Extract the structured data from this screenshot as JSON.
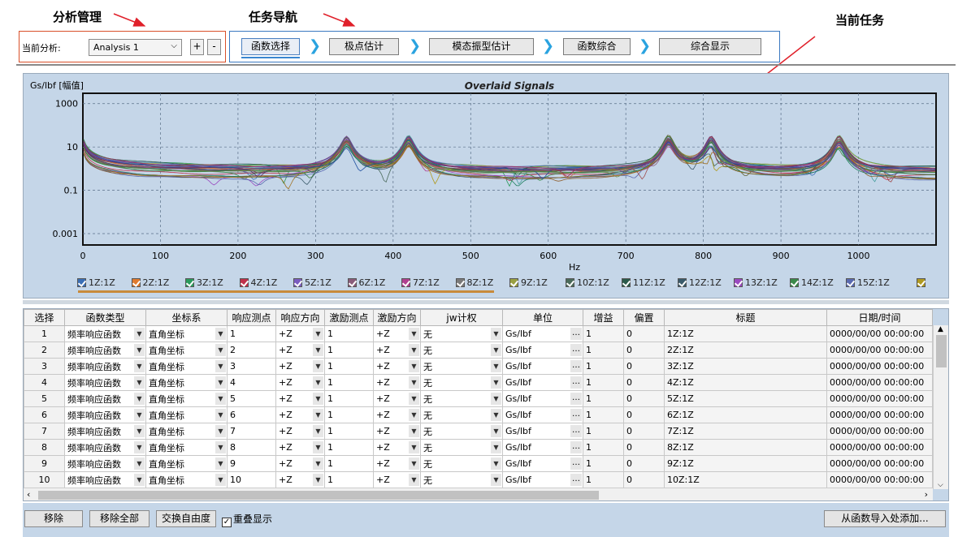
{
  "annotations": {
    "analysis_mgmt": "分析管理",
    "task_nav": "任务导航",
    "current_task": "当前任务"
  },
  "analysis": {
    "label": "当前分析:",
    "value": "Analysis 1",
    "plus": "+",
    "minus": "-"
  },
  "steps": [
    "函数选择",
    "极点估计",
    "模态振型估计",
    "函数综合",
    "综合显示"
  ],
  "chart_data": {
    "type": "line",
    "title": "Overlaid Signals",
    "ylabel": "Gs/lbf [幅值]",
    "xlabel": "Hz",
    "yscale": "log",
    "ylim": [
      0.0003,
      3000
    ],
    "xlim": [
      0,
      1100
    ],
    "yticks": [
      "1000",
      "10",
      "0.1",
      "0.001"
    ],
    "xticks": [
      "0",
      "100",
      "200",
      "300",
      "400",
      "500",
      "600",
      "700",
      "800",
      "900",
      "1000"
    ],
    "grid": true,
    "peaks_hz": [
      340,
      420,
      755,
      810,
      975
    ],
    "legend": [
      "1Z:1Z",
      "2Z:1Z",
      "3Z:1Z",
      "4Z:1Z",
      "5Z:1Z",
      "6Z:1Z",
      "7Z:1Z",
      "8Z:1Z",
      "9Z:1Z",
      "10Z:1Z",
      "11Z:1Z",
      "12Z:1Z",
      "13Z:1Z",
      "14Z:1Z",
      "15Z:1Z"
    ],
    "legend_colors": [
      "#3b6fb5",
      "#e07a2e",
      "#2a9a5c",
      "#c0304a",
      "#7a5cc0",
      "#8a5c7a",
      "#b04090",
      "#7a7a7a",
      "#9aa040",
      "#4a6a5a",
      "#2a5a4a",
      "#3a5a6a",
      "#9a4ac0",
      "#3a8a4a",
      "#5a6ab0",
      "#b09a20"
    ]
  },
  "table": {
    "headers": [
      "选择",
      "函数类型",
      "坐标系",
      "响应测点",
      "响应方向",
      "激励测点",
      "激励方向",
      "jw计权",
      "单位",
      "增益",
      "偏置",
      "标题",
      "日期/时间"
    ],
    "rows": [
      [
        "1",
        "频率响应函数",
        "直角坐标",
        "1",
        "+Z",
        "1",
        "+Z",
        "无",
        "Gs/lbf",
        "1",
        "0",
        "1Z:1Z",
        "0000/00/00 00:00:00"
      ],
      [
        "2",
        "频率响应函数",
        "直角坐标",
        "2",
        "+Z",
        "1",
        "+Z",
        "无",
        "Gs/lbf",
        "1",
        "0",
        "2Z:1Z",
        "0000/00/00 00:00:00"
      ],
      [
        "3",
        "频率响应函数",
        "直角坐标",
        "3",
        "+Z",
        "1",
        "+Z",
        "无",
        "Gs/lbf",
        "1",
        "0",
        "3Z:1Z",
        "0000/00/00 00:00:00"
      ],
      [
        "4",
        "频率响应函数",
        "直角坐标",
        "4",
        "+Z",
        "1",
        "+Z",
        "无",
        "Gs/lbf",
        "1",
        "0",
        "4Z:1Z",
        "0000/00/00 00:00:00"
      ],
      [
        "5",
        "频率响应函数",
        "直角坐标",
        "5",
        "+Z",
        "1",
        "+Z",
        "无",
        "Gs/lbf",
        "1",
        "0",
        "5Z:1Z",
        "0000/00/00 00:00:00"
      ],
      [
        "6",
        "频率响应函数",
        "直角坐标",
        "6",
        "+Z",
        "1",
        "+Z",
        "无",
        "Gs/lbf",
        "1",
        "0",
        "6Z:1Z",
        "0000/00/00 00:00:00"
      ],
      [
        "7",
        "频率响应函数",
        "直角坐标",
        "7",
        "+Z",
        "1",
        "+Z",
        "无",
        "Gs/lbf",
        "1",
        "0",
        "7Z:1Z",
        "0000/00/00 00:00:00"
      ],
      [
        "8",
        "频率响应函数",
        "直角坐标",
        "8",
        "+Z",
        "1",
        "+Z",
        "无",
        "Gs/lbf",
        "1",
        "0",
        "8Z:1Z",
        "0000/00/00 00:00:00"
      ],
      [
        "9",
        "频率响应函数",
        "直角坐标",
        "9",
        "+Z",
        "1",
        "+Z",
        "无",
        "Gs/lbf",
        "1",
        "0",
        "9Z:1Z",
        "0000/00/00 00:00:00"
      ],
      [
        "10",
        "频率响应函数",
        "直角坐标",
        "10",
        "+Z",
        "1",
        "+Z",
        "无",
        "Gs/lbf",
        "1",
        "0",
        "10Z:1Z",
        "0000/00/00 00:00:00"
      ]
    ]
  },
  "bottom": {
    "remove": "移除",
    "remove_all": "移除全部",
    "swap_dof": "交换自由度",
    "overlay": "重叠显示",
    "add_from_import": "从函数导入处添加..."
  }
}
